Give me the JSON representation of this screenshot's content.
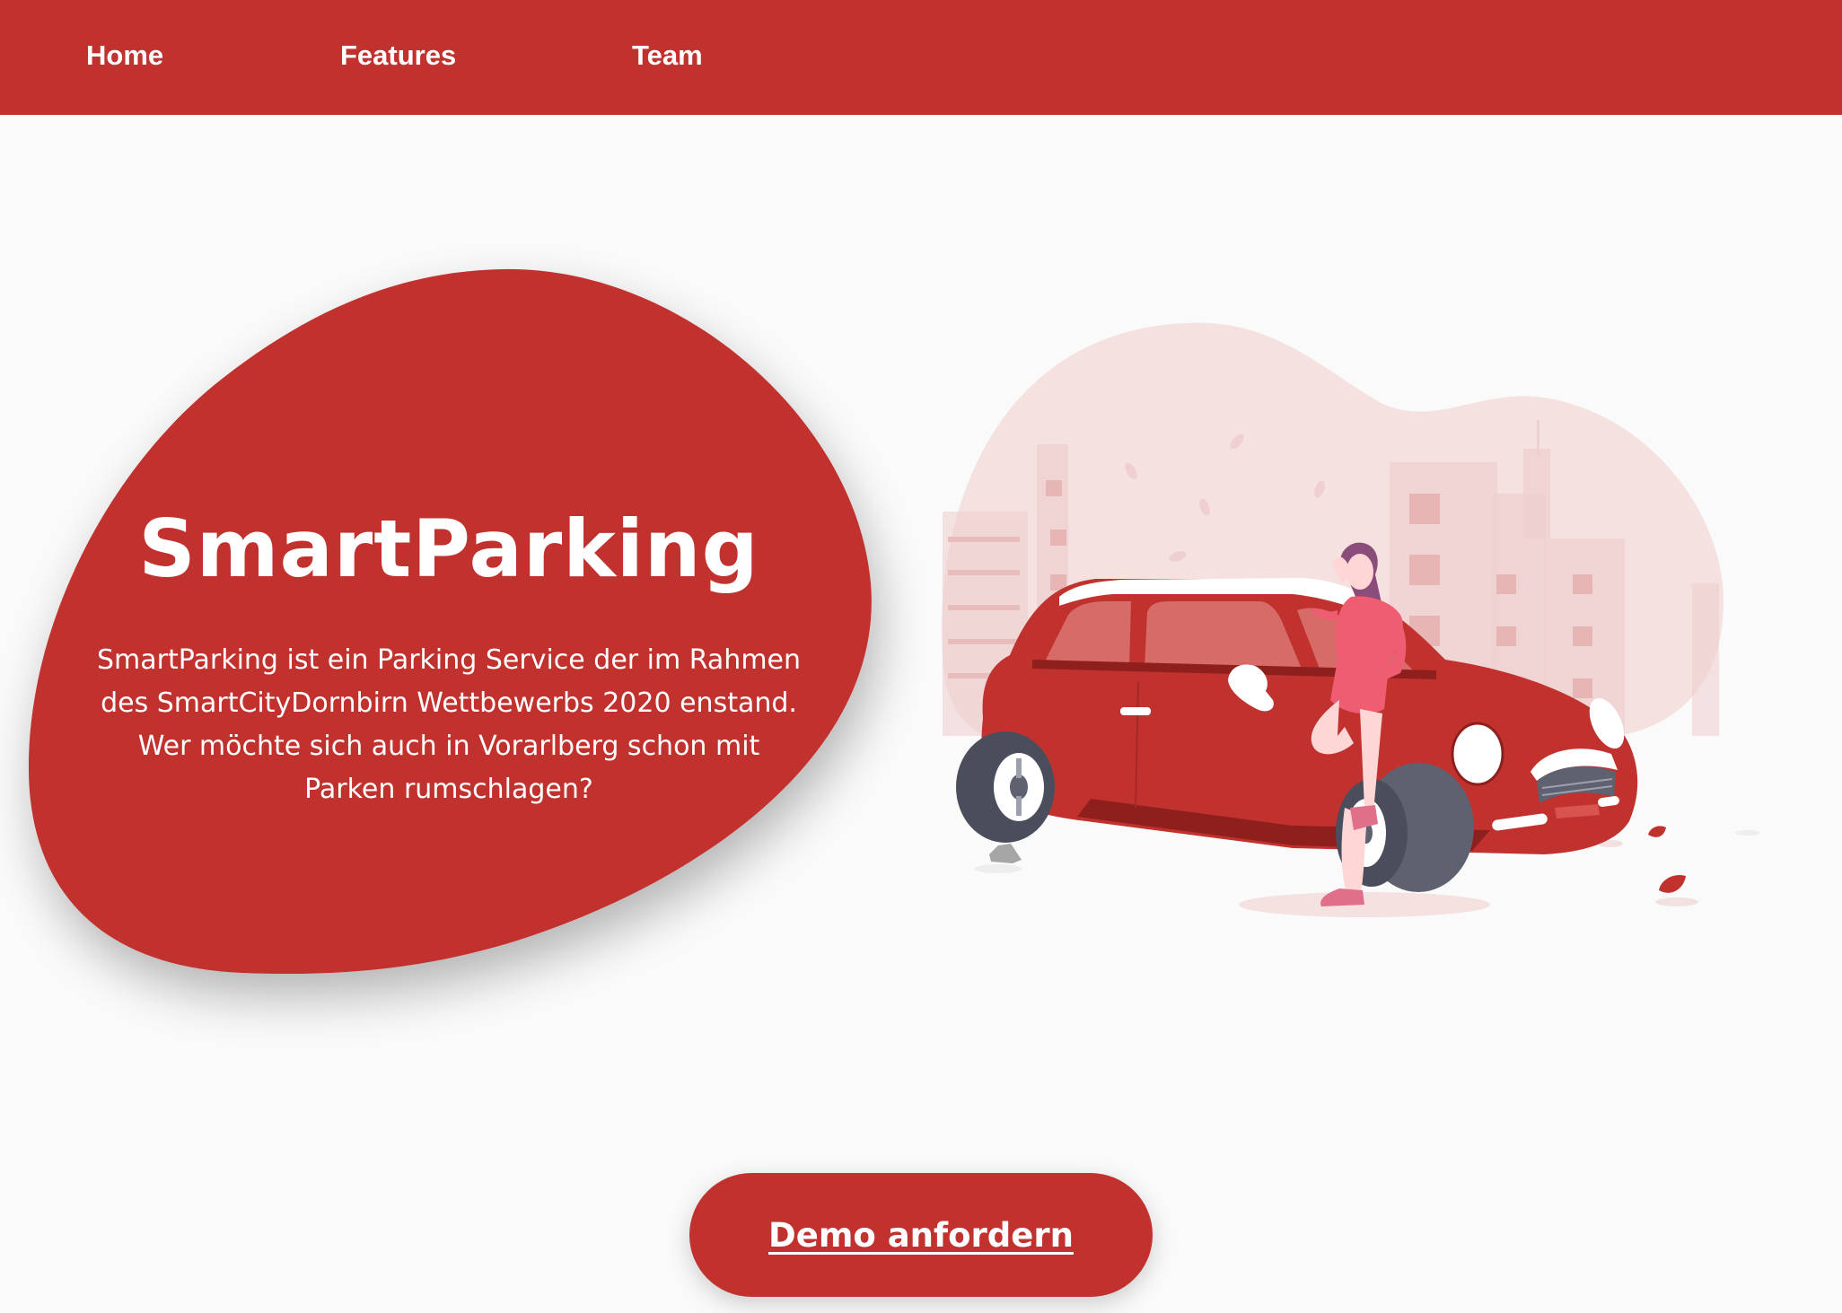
{
  "nav": {
    "items": [
      {
        "label": "Home"
      },
      {
        "label": "Features"
      },
      {
        "label": "Team"
      }
    ]
  },
  "hero": {
    "title": "SmartParking",
    "description": "SmartParking ist ein Parking Service der im Rahmen des SmartCityDornbirn Wettbewerbs 2020 enstand. Wer möchte sich auch in Vorarlberg schon mit Parken rumschlagen?",
    "illustration_icon": "woman-leaning-on-red-car-illustration"
  },
  "cta": {
    "label": "Demo anfordern"
  },
  "colors": {
    "brand_red": "#c1322f",
    "background": "#fafafa",
    "text_on_brand": "#ffffff"
  }
}
